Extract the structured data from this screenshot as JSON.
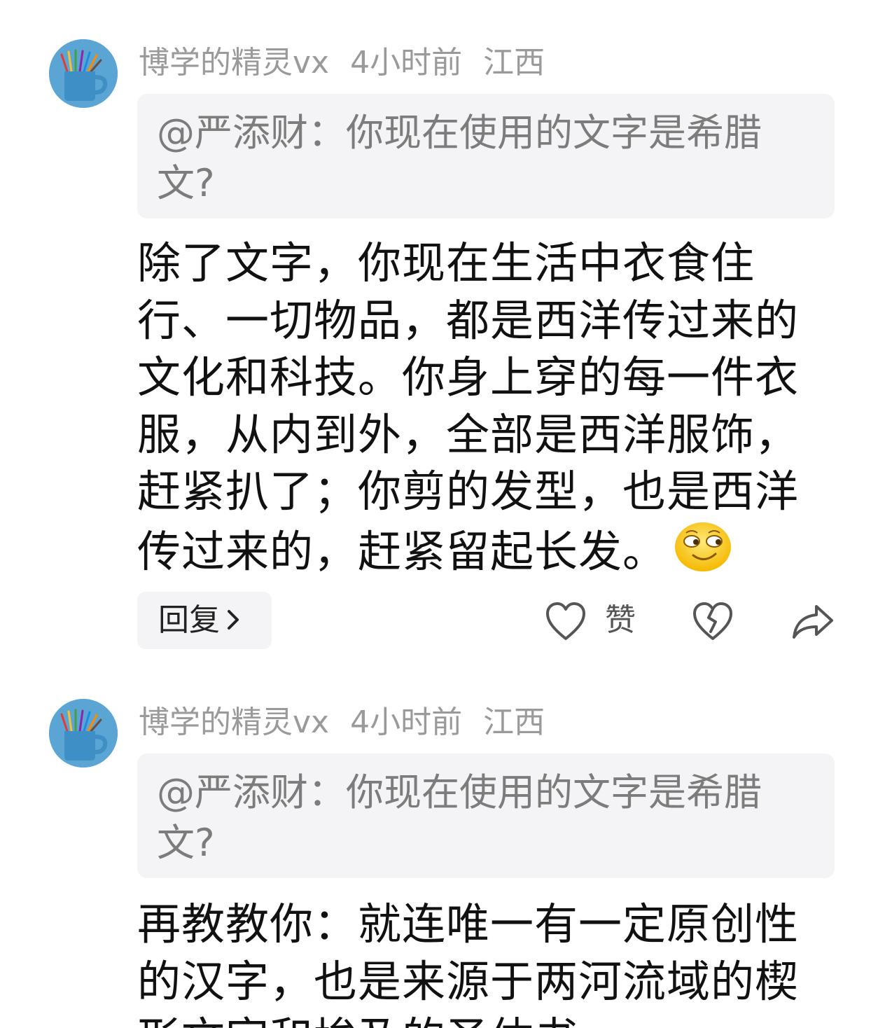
{
  "comments": [
    {
      "username": "博学的精灵vx",
      "time": "4小时前",
      "location": "江西",
      "quote": "@严添财：你现在使用的文字是希腊文?",
      "text": "除了文字，你现在生活中衣食住行、一切物品，都是西洋传过来的文化和科技。你身上穿的每一件衣服，从内到外，全部是西洋服饰，赶紧扒了；你剪的发型，也是西洋传过来的，赶紧留起长发。",
      "emoji_icon": "smirk-emoji-icon",
      "reply_label": "回复",
      "like_label": "赞"
    },
    {
      "username": "博学的精灵vx",
      "time": "4小时前",
      "location": "江西",
      "quote": "@严添财：你现在使用的文字是希腊文?",
      "text": "再教教你：就连唯一有一定原创性的汉字，也是来源于两河流域的楔形文字和埃及的圣体书"
    }
  ],
  "icons": [
    "avatar-pencil-cup-icon",
    "heart-icon",
    "broken-heart-icon",
    "share-arrow-icon",
    "chevron-right-icon"
  ],
  "colors": {
    "meta": "#9a9a9a",
    "quote_bg": "#f4f4f6",
    "text": "#111111",
    "avatar_bg": "#5aa5d3"
  }
}
